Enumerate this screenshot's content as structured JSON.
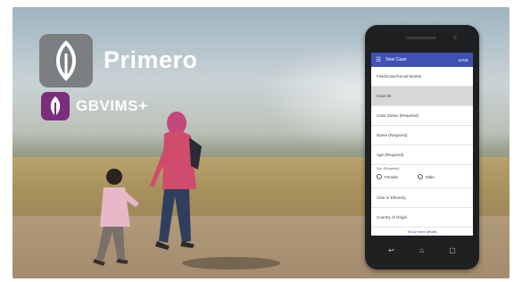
{
  "brand": {
    "primary_name": "Primero",
    "secondary_name": "GBVIMS+"
  },
  "phone": {
    "app_bar": {
      "title": "New Case",
      "action": "SAVE"
    },
    "form_fields": [
      {
        "label": "Field/Case/Social Worker"
      },
      {
        "label": "Case ID"
      },
      {
        "label": "Case Status (Required)"
      },
      {
        "label": "Name (Required)"
      },
      {
        "label": "Age (Required)"
      }
    ],
    "sex": {
      "label": "Sex (Required)",
      "options": [
        "Female",
        "Male"
      ]
    },
    "more_fields": [
      {
        "label": "Clan or Ethnicity"
      },
      {
        "label": "Country of Origin"
      }
    ],
    "show_more": "Show more details"
  },
  "colors": {
    "app_bar": "#3f51b5",
    "primero_logo_bg": "#7c7f82",
    "gbvims_logo_bg": "#7a2e7b"
  },
  "icons": [
    "primero-leaf-icon",
    "gbvims-leaf-icon",
    "menu-icon",
    "back-icon",
    "home-icon",
    "recents-icon"
  ]
}
